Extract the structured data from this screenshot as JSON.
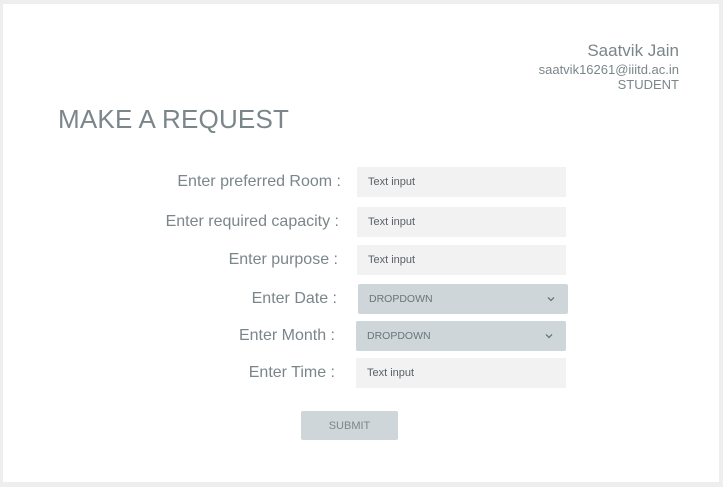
{
  "user": {
    "name": "Saatvik Jain",
    "email": "saatvik16261@iiitd.ac.in",
    "role": "STUDENT"
  },
  "page": {
    "title": "MAKE A REQUEST"
  },
  "form": {
    "room": {
      "label": "Enter preferred Room :",
      "placeholder": "Text input"
    },
    "capacity": {
      "label": "Enter required capacity :",
      "placeholder": "Text input"
    },
    "purpose": {
      "label": "Enter purpose :",
      "placeholder": "Text input"
    },
    "date": {
      "label": "Enter Date :",
      "value": "DROPDOWN",
      "icon": "chevron-down-icon"
    },
    "month": {
      "label": "Enter Month :",
      "value": "DROPDOWN",
      "icon": "chevron-down-icon"
    },
    "time": {
      "label": "Enter Time :",
      "placeholder": "Text input"
    },
    "submit_label": "SUBMIT"
  }
}
